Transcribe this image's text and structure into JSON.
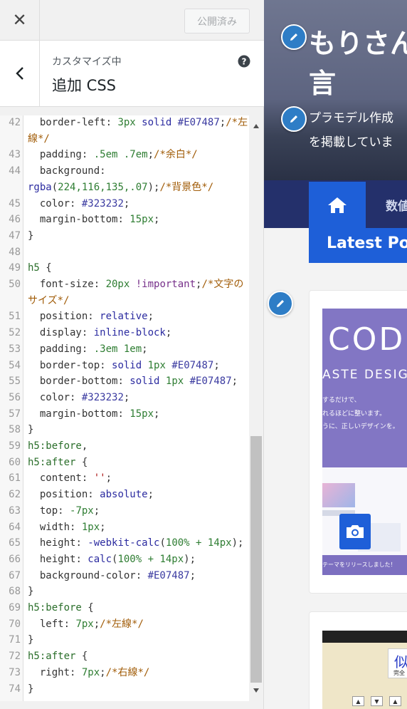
{
  "topbar": {
    "close_glyph": "✕",
    "publish_label": "公開済み"
  },
  "section": {
    "customizing_label": "カスタマイズ中",
    "title": "追加 CSS"
  },
  "editor": {
    "lines": [
      {
        "n": "42",
        "tokens": [
          [
            "prop",
            "  border-left"
          ],
          [
            "br",
            ": "
          ],
          [
            "num",
            "3px"
          ],
          [
            "br",
            " "
          ],
          [
            "val",
            "solid"
          ],
          [
            "br",
            " "
          ],
          [
            "hex",
            "#E07487"
          ],
          [
            "br",
            ";"
          ],
          [
            "cmt",
            "/*左"
          ]
        ]
      },
      {
        "n": "",
        "tokens": [
          [
            "cmt",
            "線*/"
          ]
        ]
      },
      {
        "n": "43",
        "tokens": [
          [
            "prop",
            "  padding"
          ],
          [
            "br",
            ": "
          ],
          [
            "num",
            ".5em .7em"
          ],
          [
            "br",
            ";"
          ],
          [
            "cmt",
            "/*余白*/"
          ]
        ]
      },
      {
        "n": "44",
        "tokens": [
          [
            "prop",
            "  background"
          ],
          [
            "br",
            ":"
          ]
        ]
      },
      {
        "n": "",
        "tokens": [
          [
            "val",
            "rgba"
          ],
          [
            "br",
            "("
          ],
          [
            "num",
            "224,116,135,.07"
          ],
          [
            "br",
            ");"
          ],
          [
            "cmt",
            "/*背景色*/"
          ]
        ]
      },
      {
        "n": "45",
        "tokens": [
          [
            "prop",
            "  color"
          ],
          [
            "br",
            ": "
          ],
          [
            "hex",
            "#323232"
          ],
          [
            "br",
            ";"
          ]
        ]
      },
      {
        "n": "46",
        "tokens": [
          [
            "prop",
            "  margin-bottom"
          ],
          [
            "br",
            ": "
          ],
          [
            "num",
            "15px"
          ],
          [
            "br",
            ";"
          ]
        ]
      },
      {
        "n": "47",
        "tokens": [
          [
            "br",
            "}"
          ]
        ]
      },
      {
        "n": "48",
        "tokens": []
      },
      {
        "n": "49",
        "tokens": [
          [
            "sel",
            "h5"
          ],
          [
            "br",
            " {"
          ]
        ]
      },
      {
        "n": "50",
        "tokens": [
          [
            "prop",
            "  font-size"
          ],
          [
            "br",
            ": "
          ],
          [
            "num",
            "20px"
          ],
          [
            "br",
            " "
          ],
          [
            "imp",
            "!important"
          ],
          [
            "br",
            ";"
          ],
          [
            "cmt",
            "/*文字の"
          ]
        ]
      },
      {
        "n": "",
        "tokens": [
          [
            "cmt",
            "サイズ*/"
          ]
        ]
      },
      {
        "n": "51",
        "tokens": [
          [
            "prop",
            "  position"
          ],
          [
            "br",
            ": "
          ],
          [
            "val",
            "relative"
          ],
          [
            "br",
            ";"
          ]
        ]
      },
      {
        "n": "52",
        "tokens": [
          [
            "prop",
            "  display"
          ],
          [
            "br",
            ": "
          ],
          [
            "val",
            "inline-block"
          ],
          [
            "br",
            ";"
          ]
        ]
      },
      {
        "n": "53",
        "tokens": [
          [
            "prop",
            "  padding"
          ],
          [
            "br",
            ": "
          ],
          [
            "num",
            ".3em 1em"
          ],
          [
            "br",
            ";"
          ]
        ]
      },
      {
        "n": "54",
        "tokens": [
          [
            "prop",
            "  border-top"
          ],
          [
            "br",
            ": "
          ],
          [
            "val",
            "solid"
          ],
          [
            "br",
            " "
          ],
          [
            "num",
            "1px"
          ],
          [
            "br",
            " "
          ],
          [
            "hex",
            "#E07487"
          ],
          [
            "br",
            ";"
          ]
        ]
      },
      {
        "n": "55",
        "tokens": [
          [
            "prop",
            "  border-bottom"
          ],
          [
            "br",
            ": "
          ],
          [
            "val",
            "solid"
          ],
          [
            "br",
            " "
          ],
          [
            "num",
            "1px"
          ],
          [
            "br",
            " "
          ],
          [
            "hex",
            "#E07487"
          ],
          [
            "br",
            ";"
          ]
        ]
      },
      {
        "n": "56",
        "tokens": [
          [
            "prop",
            "  color"
          ],
          [
            "br",
            ": "
          ],
          [
            "hex",
            "#323232"
          ],
          [
            "br",
            ";"
          ]
        ]
      },
      {
        "n": "57",
        "tokens": [
          [
            "prop",
            "  margin-bottom"
          ],
          [
            "br",
            ": "
          ],
          [
            "num",
            "15px"
          ],
          [
            "br",
            ";"
          ]
        ]
      },
      {
        "n": "58",
        "tokens": [
          [
            "br",
            "}"
          ]
        ]
      },
      {
        "n": "59",
        "tokens": [
          [
            "sel",
            "h5:before"
          ],
          [
            "br",
            ","
          ]
        ]
      },
      {
        "n": "60",
        "tokens": [
          [
            "sel",
            "h5:after"
          ],
          [
            "br",
            " {"
          ]
        ]
      },
      {
        "n": "61",
        "tokens": [
          [
            "prop",
            "  content"
          ],
          [
            "br",
            ": "
          ],
          [
            "str",
            "''"
          ],
          [
            "br",
            ";"
          ]
        ]
      },
      {
        "n": "62",
        "tokens": [
          [
            "prop",
            "  position"
          ],
          [
            "br",
            ": "
          ],
          [
            "val",
            "absolute"
          ],
          [
            "br",
            ";"
          ]
        ]
      },
      {
        "n": "63",
        "tokens": [
          [
            "prop",
            "  top"
          ],
          [
            "br",
            ": "
          ],
          [
            "num",
            "-7px"
          ],
          [
            "br",
            ";"
          ]
        ]
      },
      {
        "n": "64",
        "tokens": [
          [
            "prop",
            "  width"
          ],
          [
            "br",
            ": "
          ],
          [
            "num",
            "1px"
          ],
          [
            "br",
            ";"
          ]
        ]
      },
      {
        "n": "65",
        "tokens": [
          [
            "prop",
            "  height"
          ],
          [
            "br",
            ": "
          ],
          [
            "val",
            "-webkit-calc"
          ],
          [
            "br",
            "("
          ],
          [
            "num",
            "100% + 14px"
          ],
          [
            "br",
            ");"
          ]
        ]
      },
      {
        "n": "66",
        "tokens": [
          [
            "prop",
            "  height"
          ],
          [
            "br",
            ": "
          ],
          [
            "val",
            "calc"
          ],
          [
            "br",
            "("
          ],
          [
            "num",
            "100% + 14px"
          ],
          [
            "br",
            ");"
          ]
        ]
      },
      {
        "n": "67",
        "tokens": [
          [
            "prop",
            "  background-color"
          ],
          [
            "br",
            ": "
          ],
          [
            "hex",
            "#E07487"
          ],
          [
            "br",
            ";"
          ]
        ]
      },
      {
        "n": "68",
        "tokens": [
          [
            "br",
            "}"
          ]
        ]
      },
      {
        "n": "69",
        "tokens": [
          [
            "sel",
            "h5:before"
          ],
          [
            "br",
            " {"
          ]
        ]
      },
      {
        "n": "70",
        "tokens": [
          [
            "prop",
            "  left"
          ],
          [
            "br",
            ": "
          ],
          [
            "num",
            "7px"
          ],
          [
            "br",
            ";"
          ],
          [
            "cmt",
            "/*左線*/"
          ]
        ]
      },
      {
        "n": "71",
        "tokens": [
          [
            "br",
            "}"
          ]
        ]
      },
      {
        "n": "72",
        "tokens": [
          [
            "sel",
            "h5:after"
          ],
          [
            "br",
            " {"
          ]
        ]
      },
      {
        "n": "73",
        "tokens": [
          [
            "prop",
            "  right"
          ],
          [
            "br",
            ": "
          ],
          [
            "num",
            "7px"
          ],
          [
            "br",
            ";"
          ],
          [
            "cmt",
            "/*右線*/"
          ]
        ]
      },
      {
        "n": "74",
        "tokens": [
          [
            "br",
            "}"
          ]
        ]
      }
    ]
  },
  "preview": {
    "hero_title": "もりさん",
    "hero_title_line2": "言",
    "hero_desc": "プラモデル作成",
    "hero_desc_line2": "を掲載していま",
    "nav_numbers": "数値",
    "latest_label": "Latest Pos",
    "card1": {
      "img_code": "CODE",
      "img_design": "ASTE DESIGN",
      "img_line1": "するだけで、",
      "img_line2": "れるほどに整います。",
      "img_line3": "うに、正しいデザインを。",
      "img_release": "テーマをリリースしました！"
    },
    "card2": {
      "heading": "似",
      "sub": "完全"
    }
  },
  "icons": {
    "close": "close-icon",
    "back": "chevron-left-icon",
    "help": "help-icon",
    "edit": "pencil-icon",
    "home": "home-icon",
    "camera": "camera-icon"
  },
  "colors": {
    "accent": "#1e5fd8",
    "nav": "#24306b",
    "pin": "#2e7dc6"
  }
}
